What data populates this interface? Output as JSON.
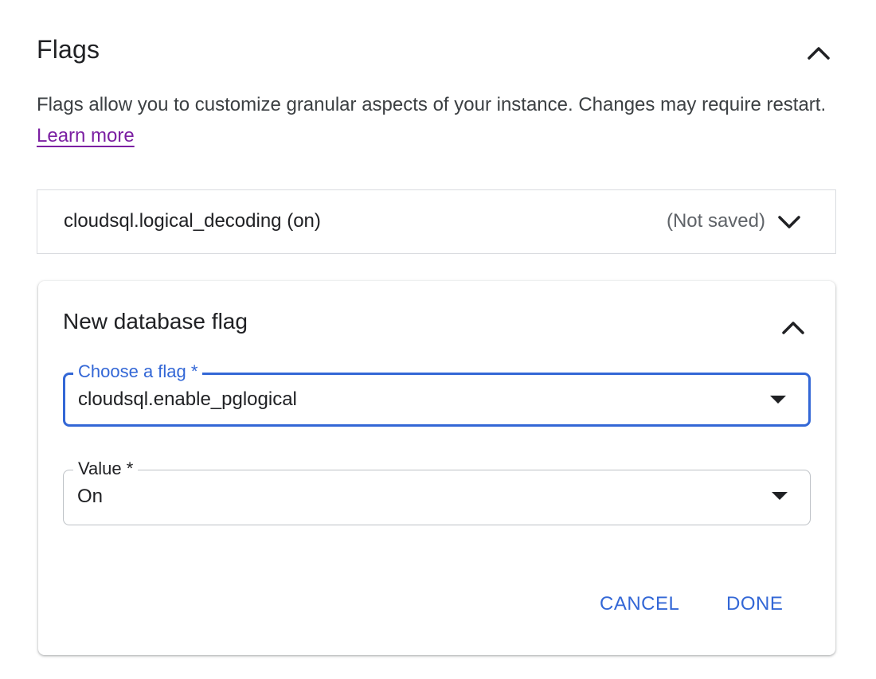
{
  "section": {
    "title": "Flags",
    "description": "Flags allow you to customize granular aspects of your instance. Changes may require restart.",
    "learn_more": "Learn more",
    "collapse_icon": "chevron-up-icon"
  },
  "saved_flag": {
    "name": "cloudsql.logical_decoding (on)",
    "status": "(Not saved)",
    "expand_icon": "chevron-down-icon"
  },
  "new_flag": {
    "title": "New database flag",
    "collapse_icon": "chevron-up-icon",
    "flag_field": {
      "label": "Choose a flag *",
      "value": "cloudsql.enable_pglogical"
    },
    "value_field": {
      "label": "Value *",
      "value": "On"
    },
    "buttons": {
      "cancel": "CANCEL",
      "done": "DONE"
    }
  },
  "colors": {
    "accent": "#3367d6",
    "link": "#7b1fa2",
    "text": "#202124",
    "muted": "#5f6368",
    "border": "#dadce0"
  }
}
